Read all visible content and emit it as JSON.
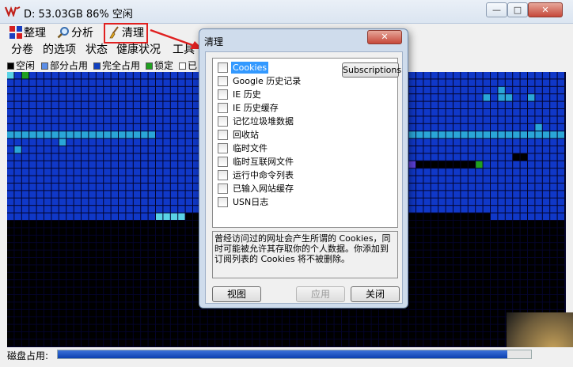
{
  "window": {
    "title": "D:  53.03GB 86% 空闲",
    "min_glyph": "—",
    "max_glyph": "□",
    "close_glyph": "✕"
  },
  "toolbar": {
    "defrag_label": "整理",
    "analyze_label": "分析",
    "clean_label": "清理"
  },
  "menu": [
    "分卷",
    "的选项",
    "状态",
    "健康状况",
    "工具"
  ],
  "legend": [
    {
      "label": "空闲",
      "color": "#000000"
    },
    {
      "label": "部分占用",
      "color": "#5b8ee8"
    },
    {
      "label": "完全占用",
      "color": "#1040c0"
    },
    {
      "label": "锁定",
      "color": "#20a020"
    },
    {
      "label": "已",
      "color": "#ffffff"
    }
  ],
  "diskmap": {
    "grid_color": "#04042a",
    "free_color": "#000000",
    "used_color": "#1038c8",
    "partial_color": "#2aa6d8",
    "partial_alt_color": "#39c8d8",
    "locked_color": "#20a020",
    "marker_color": "#5b40d8",
    "bright_partial_color": "#5ad3e6"
  },
  "statusbar": {
    "usage_label": "磁盘占用:",
    "usage_fraction": 0.95
  },
  "dialog": {
    "title": "清理",
    "close_glyph": "✕",
    "items": [
      {
        "label": "Cookies",
        "checked": false,
        "selected": true
      },
      {
        "label": "Google 历史记录",
        "checked": false
      },
      {
        "label": "IE 历史",
        "checked": false
      },
      {
        "label": "IE 历史缓存",
        "checked": false
      },
      {
        "label": "记忆垃圾堆数据",
        "checked": false
      },
      {
        "label": "回收站",
        "checked": false
      },
      {
        "label": "临时文件",
        "checked": false
      },
      {
        "label": "临时互联网文件",
        "checked": false
      },
      {
        "label": "运行中命令列表",
        "checked": false
      },
      {
        "label": "已输入网站缓存",
        "checked": false
      },
      {
        "label": "USN日志",
        "checked": false
      }
    ],
    "subscriptions_label": "Subscriptions",
    "description": "曾经访问过的网址会产生所谓的 Cookies，同时可能被允许其存取你的个人数据。你添加到订阅列表的 Cookies 将不被删除。",
    "view_label": "视图",
    "apply_label": "应用",
    "close_label": "关闭"
  }
}
